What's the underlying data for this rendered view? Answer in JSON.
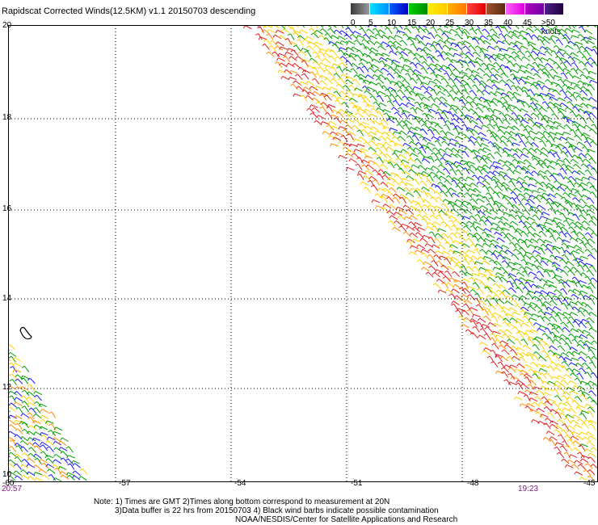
{
  "title": "Rapidscat Corrected Winds(12.5KM) v1.1 20150703 descending",
  "legend": {
    "labels": [
      "0",
      "5",
      "10",
      "15",
      "20",
      "25",
      "30",
      "35",
      "40",
      "45",
      ">50 knots"
    ],
    "colors": [
      "#5a5a5a",
      "#00bfff",
      "#0000ff",
      "#00b000",
      "#ffd200",
      "#ff8c00",
      "#ff2020",
      "#8b1a1a",
      "#ff00ff",
      "#7a2ab0",
      "#000000"
    ]
  },
  "axes": {
    "lat_labels": [
      "20",
      "18",
      "16",
      "14",
      "12",
      "10"
    ],
    "lon_labels": [
      "-60",
      "-57",
      "-54",
      "-51",
      "-48",
      "-45"
    ]
  },
  "times": {
    "left": "20:57",
    "right": "19:23"
  },
  "notes": {
    "line1": "Note: 1) Times are GMT 2)Times along bottom correspond to measurement at 20N",
    "line2": "3)Data buffer is 22 hrs from 20150703 4) Black wind barbs indicate possible contamination",
    "line3": "NOAA/NESDIS/Center for Satellite Applications and Research"
  }
}
